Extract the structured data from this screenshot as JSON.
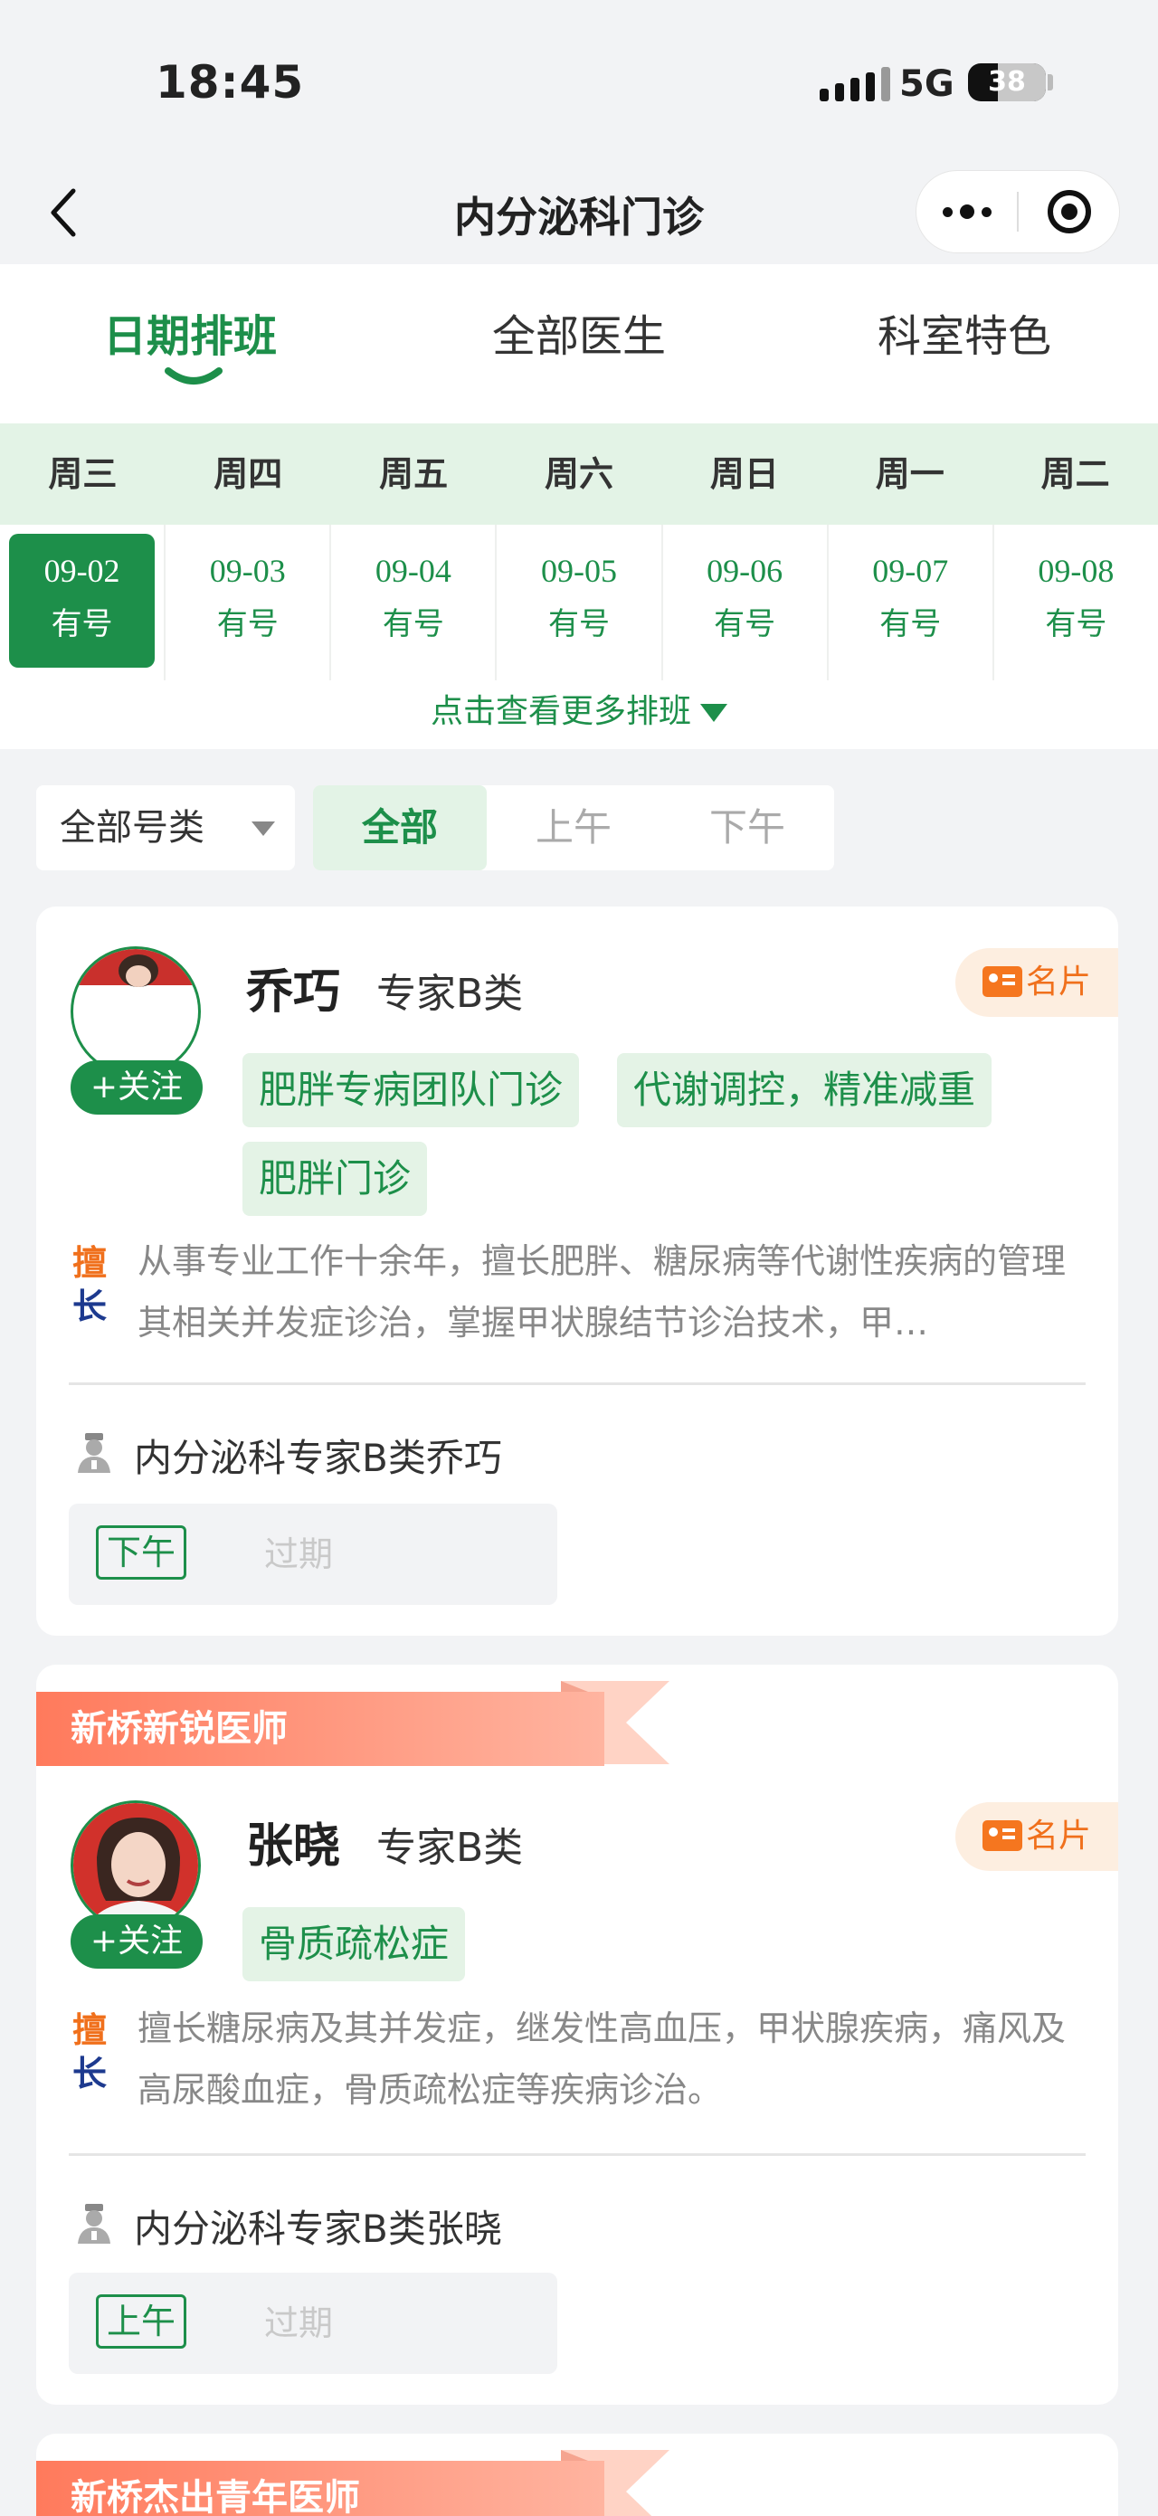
{
  "status": {
    "time": "18:45",
    "network": "5G",
    "battery": "38",
    "battery_level": 0.38
  },
  "nav": {
    "title": "内分泌科门诊"
  },
  "tabs": [
    {
      "label": "日期排班",
      "active": true
    },
    {
      "label": "全部医生",
      "active": false
    },
    {
      "label": "科室特色",
      "active": false
    }
  ],
  "week": [
    "周三",
    "周四",
    "周五",
    "周六",
    "周日",
    "周一",
    "周二"
  ],
  "dates": [
    {
      "date": "09-02",
      "status": "有号",
      "selected": true
    },
    {
      "date": "09-03",
      "status": "有号"
    },
    {
      "date": "09-04",
      "status": "有号"
    },
    {
      "date": "09-05",
      "status": "有号"
    },
    {
      "date": "09-06",
      "status": "有号"
    },
    {
      "date": "09-07",
      "status": "有号"
    },
    {
      "date": "09-08",
      "status": "有号"
    }
  ],
  "more_schedule": "点击查看更多排班",
  "filters": {
    "type": "全部号类",
    "segments": [
      "全部",
      "上午",
      "下午"
    ],
    "active": "全部"
  },
  "labels": {
    "follow": "+关注",
    "card": "名片",
    "good_at_1": "擅",
    "good_at_2": "长",
    "expired": "过期"
  },
  "doctors": [
    {
      "name": "乔巧",
      "level": "专家B类",
      "tags": [
        "肥胖专病团队门诊",
        "代谢调控，精准减重",
        "肥胖门诊"
      ],
      "intro": "从事专业工作十余年，擅长肥胖、糖尿病等代谢性疾病的管理其相关并发症诊治，掌握甲状腺结节诊治技术，甲…",
      "dept": "内分泌科专家B类乔巧",
      "slot": "下午"
    },
    {
      "ribbon": "新桥新锐医师",
      "name": "张晓",
      "level": "专家B类",
      "tags": [
        "骨质疏松症"
      ],
      "intro": "擅长糖尿病及其并发症，继发性高血压，甲状腺疾病，痛风及高尿酸血症，骨质疏松症等疾病诊治。",
      "dept": "内分泌科专家B类张晓",
      "slot": "上午"
    }
  ],
  "next_ribbon": "新桥杰出青年医师",
  "colors": {
    "accent": "#1d8f4a",
    "accent_light": "#e3f3e6",
    "card_orange": "#f0701c",
    "ribbon": "#ff7a5c"
  }
}
